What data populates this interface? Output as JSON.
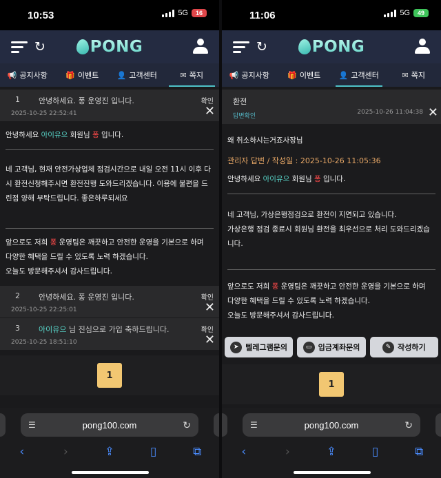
{
  "left": {
    "status": {
      "time": "10:53",
      "network": "5G",
      "battery": "16"
    },
    "header": {
      "logo": "PONG"
    },
    "tabs": [
      {
        "label": "공지사항",
        "icon": "megaphone-icon",
        "glyph": "📢"
      },
      {
        "label": "이벤트",
        "icon": "gift-icon",
        "glyph": "🎁"
      },
      {
        "label": "고객센터",
        "icon": "headset-icon",
        "glyph": "👤"
      },
      {
        "label": "쪽지",
        "icon": "message-icon",
        "glyph": "✉"
      }
    ],
    "messages": [
      {
        "num": "1",
        "title": "안녕하세요. 퐁 운영진 입니다.",
        "date": "2025-10-25 22:52:41",
        "confirm": "확인"
      },
      {
        "num": "2",
        "title": "안녕하세요. 퐁 운영진 입니다.",
        "date": "2025-10-25 22:25:01",
        "confirm": "확인"
      },
      {
        "num": "3",
        "title_pre": "아이유으",
        "title_post": " 님 진심으로 가입 축하드립니다.",
        "date": "2025-10-25 18:51:10",
        "confirm": "확인"
      }
    ],
    "body": {
      "greet_pre": "안녕하세요 ",
      "greet_name": "아이유으",
      "greet_mid": " 회원님 ",
      "greet_brand": "퐁",
      "greet_post": " 입니다.",
      "para1": "네 고객님, 현재 안전가상업체 점검시간으로 내일 오전 11시 이후 다시 환전신청해주시면 환전진행 도와드리겠습니다. 이용에 불편을 드린점 양해 부탁드립니다. 좋은하루되세요",
      "closing_pre": "앞으로도 저희 ",
      "closing_brand": "퐁",
      "closing_post": " 운영팀은 깨끗하고 안전한 운영을 기본으로 하며",
      "closing2": "다양한 혜택을 드릴 수 있도록 노력 하겠습니다.",
      "closing3": "오늘도 방문해주셔서 감사드립니다."
    },
    "page": "1",
    "url": "pong100.com"
  },
  "right": {
    "status": {
      "time": "11:06",
      "network": "5G",
      "battery": "49"
    },
    "header": {
      "logo": "PONG"
    },
    "tabs": [
      {
        "label": "공지사항",
        "icon": "megaphone-icon",
        "glyph": "📢"
      },
      {
        "label": "이벤트",
        "icon": "gift-icon",
        "glyph": "🎁"
      },
      {
        "label": "고객센터",
        "icon": "headset-icon",
        "glyph": "👤"
      },
      {
        "label": "쪽지",
        "icon": "message-icon",
        "glyph": "✉"
      }
    ],
    "inquiry": {
      "title": "환전",
      "status": "답변확인",
      "date": "2025-10-26 11:04:38",
      "question": "왜 취소하시는거죠사장님"
    },
    "answer": {
      "admin_line": "관리자 답변 / 작성일 : 2025-10-26 11:05:36",
      "greet_pre": "안녕하세요 ",
      "greet_name": "아이유으",
      "greet_mid": " 회원님 ",
      "greet_brand": "퐁",
      "greet_post": " 입니다.",
      "para1": "네 고객님, 가상은행점검으로 환전이 지연되고 있습니다.",
      "para2": "가상은행 점검 종료시 회원님 환전을 최우선으로 처리 도와드리겠습니다.",
      "closing_pre": "앞으로도 저희 ",
      "closing_brand": "퐁",
      "closing_post": " 운영팀은 깨끗하고 안전한 운영을 기본으로 하며",
      "closing2": "다양한 혜택을 드릴 수 있도록 노력 하겠습니다.",
      "closing3": "오늘도 방문해주셔서 감사드립니다."
    },
    "buttons": [
      {
        "label": "텔레그램문의",
        "icon": "telegram-icon",
        "glyph": "➤"
      },
      {
        "label": "입금계좌문의",
        "icon": "card-icon",
        "glyph": "▭"
      },
      {
        "label": "작성하기",
        "icon": "pencil-icon",
        "glyph": "✎"
      }
    ],
    "page": "1",
    "url": "pong100.com"
  },
  "colors": {
    "accent_teal": "#58d5c9",
    "brand_red": "#ff4a4a",
    "admin_orange": "#e7a766",
    "page_yellow": "#f2c772",
    "battery_left": "#e0464a",
    "battery_right": "#3ec45a"
  }
}
